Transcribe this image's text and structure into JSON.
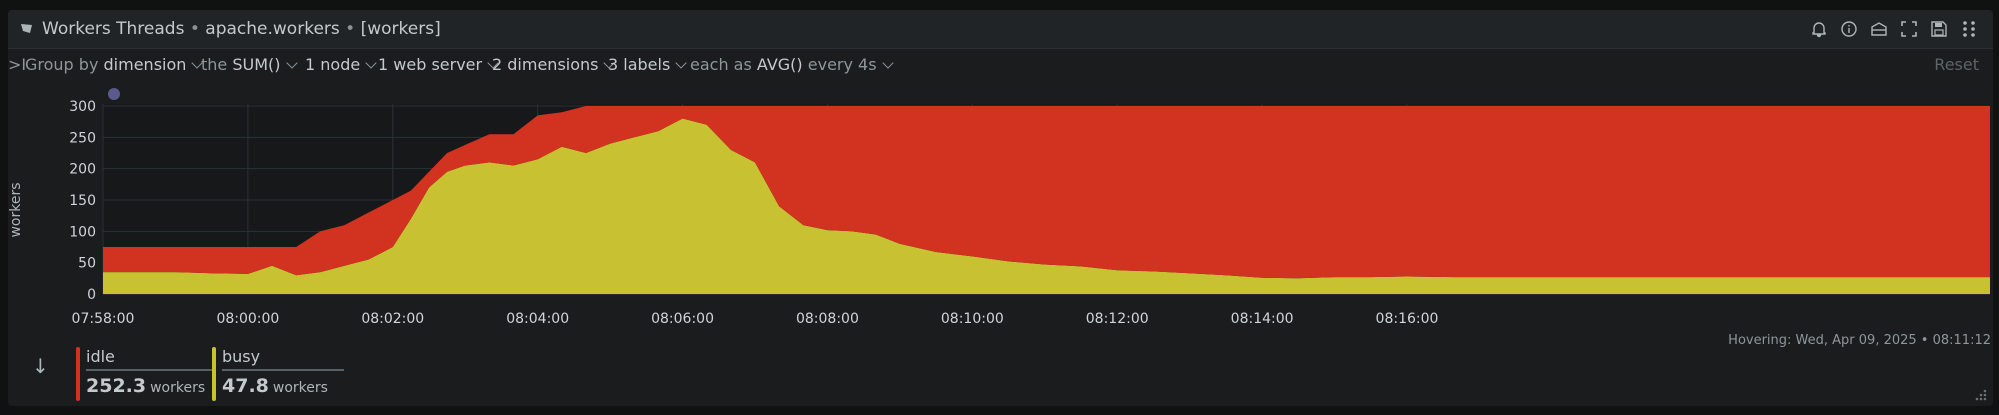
{
  "header": {
    "title": "Workers Threads",
    "context": "apache.workers",
    "family": "[workers]"
  },
  "toolbar_icons": [
    "bell-icon",
    "info-icon",
    "dashboard-icon",
    "expand-icon",
    "save-icon",
    "drag-handle-icon"
  ],
  "controls": {
    "group_by_prefix": "Group by",
    "group_by_value": "dimension",
    "agg_prefix": "the",
    "agg_value": "SUM()",
    "nodes": "1 node",
    "instances": "1 web server",
    "dimensions": "2 dimensions",
    "labels": "3 labels",
    "time_agg_prefix": "each as",
    "time_agg_value": "AVG()",
    "time_agg_suffix": "every 4s",
    "reset": "Reset"
  },
  "hover_info": "Hovering: Wed, Apr 09, 2025 • 08:11:12",
  "legend": [
    {
      "name": "idle",
      "value": "252.3",
      "unit": "workers",
      "color": "#d23321"
    },
    {
      "name": "busy",
      "value": "47.8",
      "unit": "workers",
      "color": "#c8c232"
    }
  ],
  "chart_data": {
    "type": "area",
    "stacked": true,
    "ylabel": "workers",
    "xlabel": "",
    "ylim": [
      0,
      300
    ],
    "yticks": [
      "0",
      "50",
      "100",
      "150",
      "200",
      "250",
      "300"
    ],
    "x_tick_labels": [
      "07:58:00",
      "08:00:00",
      "08:02:00",
      "08:04:00",
      "08:06:00",
      "08:08:00",
      "08:10:00",
      "08:12:00",
      "08:14:00",
      "08:16:00"
    ],
    "grid": true,
    "x": [
      "07:58:00",
      "07:58:30",
      "07:59:00",
      "07:59:30",
      "08:00:00",
      "08:00:20",
      "08:00:40",
      "08:01:00",
      "08:01:20",
      "08:01:40",
      "08:02:00",
      "08:02:15",
      "08:02:30",
      "08:02:45",
      "08:03:00",
      "08:03:20",
      "08:03:40",
      "08:04:00",
      "08:04:20",
      "08:04:40",
      "08:05:00",
      "08:05:20",
      "08:05:40",
      "08:06:00",
      "08:06:20",
      "08:06:40",
      "08:07:00",
      "08:07:20",
      "08:07:40",
      "08:08:00",
      "08:08:20",
      "08:08:40",
      "08:09:00",
      "08:09:30",
      "08:10:00",
      "08:10:30",
      "08:11:00",
      "08:11:30",
      "08:12:00",
      "08:12:30",
      "08:13:00",
      "08:13:30",
      "08:14:00",
      "08:14:30",
      "08:15:00",
      "08:15:30",
      "08:16:00",
      "08:16:40"
    ],
    "series": [
      {
        "name": "busy",
        "values": [
          35,
          35,
          35,
          33,
          32,
          45,
          30,
          35,
          45,
          55,
          75,
          120,
          170,
          195,
          205,
          210,
          205,
          215,
          235,
          225,
          240,
          250,
          260,
          280,
          270,
          230,
          210,
          140,
          110,
          102,
          100,
          95,
          80,
          67,
          60,
          52,
          47,
          44,
          38,
          36,
          33,
          30,
          26,
          25,
          27,
          27,
          28,
          27
        ]
      },
      {
        "name": "idle",
        "values": [
          40,
          40,
          40,
          42,
          43,
          30,
          45,
          65,
          65,
          75,
          75,
          45,
          25,
          30,
          33,
          45,
          50,
          70,
          55,
          75,
          60,
          50,
          40,
          20,
          30,
          70,
          90,
          160,
          190,
          198,
          200,
          205,
          220,
          233,
          240,
          248,
          253,
          256,
          262,
          264,
          267,
          270,
          274,
          275,
          273,
          273,
          272,
          273
        ]
      }
    ]
  }
}
